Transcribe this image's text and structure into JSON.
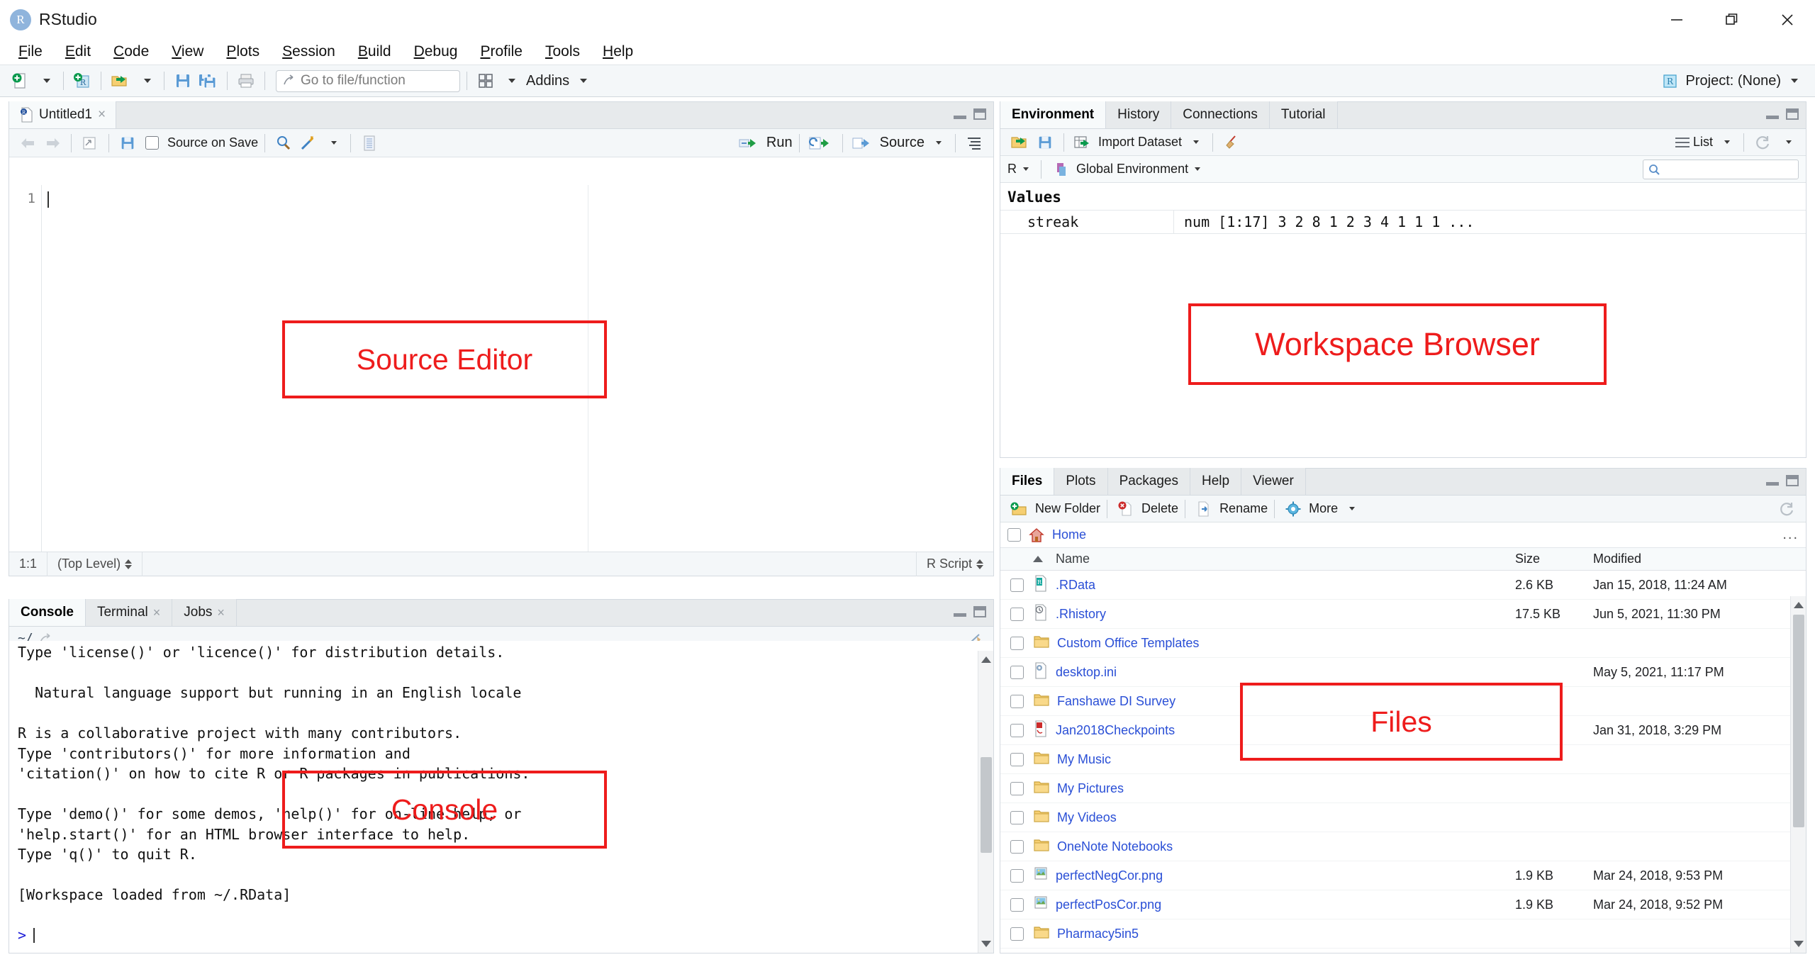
{
  "window": {
    "app_title": "RStudio",
    "logo_letter": "R",
    "controls": {
      "minimize": "minimize-button",
      "restore": "restore-button",
      "close": "close-button"
    }
  },
  "menubar": [
    {
      "label": "File",
      "accel": "F"
    },
    {
      "label": "Edit",
      "accel": "E"
    },
    {
      "label": "Code",
      "accel": "C"
    },
    {
      "label": "View",
      "accel": "V"
    },
    {
      "label": "Plots",
      "accel": "P"
    },
    {
      "label": "Session",
      "accel": "S"
    },
    {
      "label": "Build",
      "accel": "B"
    },
    {
      "label": "Debug",
      "accel": "D"
    },
    {
      "label": "Profile",
      "accel": "P"
    },
    {
      "label": "Tools",
      "accel": "T"
    },
    {
      "label": "Help",
      "accel": "H"
    }
  ],
  "toolbar": {
    "icons": [
      "new-file-icon",
      "new-project-icon",
      "open-file-icon",
      "save-icon",
      "save-all-icon",
      "print-icon"
    ],
    "goto_placeholder": "Go to file/function",
    "panes_icon": "panes-grid-icon",
    "addins_label": "Addins",
    "project_label": "Project: (None)",
    "project_icon": "r-cube-icon"
  },
  "source_editor": {
    "tab": {
      "label": "Untitled1",
      "icon": "r-script-icon",
      "close": "×"
    },
    "toolbar": {
      "back_icon": "back-arrow-icon",
      "forward_icon": "forward-arrow-icon",
      "popout_icon": "show-in-new-window-icon",
      "save_icon": "save-icon",
      "source_on_save_label": "Source on Save",
      "find_icon": "magnifier-icon",
      "wand_icon": "code-tools-wand-icon",
      "compile_icon": "compile-report-icon",
      "run_label": "Run",
      "rerun_icon": "rerun-icon",
      "source_label": "Source",
      "outline_icon": "document-outline-icon"
    },
    "gutter_line": "1",
    "status": {
      "position": "1:1",
      "scope": "(Top Level)",
      "file_type": "R Script"
    }
  },
  "console": {
    "tabs": [
      {
        "label": "Console",
        "active": true,
        "closable": false
      },
      {
        "label": "Terminal",
        "active": false,
        "closable": true
      },
      {
        "label": "Jobs",
        "active": false,
        "closable": true
      }
    ],
    "path": "~/",
    "path_icon": "open-in-window-icon",
    "lines": [
      "Type 'license()' or 'licence()' for distribution details.",
      "",
      "  Natural language support but running in an English locale",
      "",
      "R is a collaborative project with many contributors.",
      "Type 'contributors()' for more information and",
      "'citation()' on how to cite R or R packages in publications.",
      "",
      "Type 'demo()' for some demos, 'help()' for on-line help, or",
      "'help.start()' for an HTML browser interface to help.",
      "Type 'q()' to quit R.",
      "",
      "[Workspace loaded from ~/.RData]",
      ""
    ],
    "prompt": ">"
  },
  "environment": {
    "tabs": [
      {
        "label": "Environment",
        "active": true
      },
      {
        "label": "History",
        "active": false
      },
      {
        "label": "Connections",
        "active": false
      },
      {
        "label": "Tutorial",
        "active": false
      }
    ],
    "toolbar": {
      "load_icon": "load-workspace-icon",
      "save_icon": "save-workspace-icon",
      "import_label": "Import Dataset",
      "broom_icon": "clear-objects-broom-icon",
      "view_mode": "List",
      "refresh_icon": "refresh-icon"
    },
    "language": "R",
    "scope": "Global Environment",
    "scope_icon": "environment-icon",
    "search_icon": "search-icon",
    "search_value": "",
    "group_header": "Values",
    "variables": [
      {
        "name": "streak",
        "value": "num [1:17] 3 2 8 1 2 3 4 1 1 1 ..."
      }
    ]
  },
  "files": {
    "tabs": [
      {
        "label": "Files",
        "active": true
      },
      {
        "label": "Plots",
        "active": false
      },
      {
        "label": "Packages",
        "active": false
      },
      {
        "label": "Help",
        "active": false
      },
      {
        "label": "Viewer",
        "active": false
      }
    ],
    "toolbar": {
      "new_folder_label": "New Folder",
      "delete_label": "Delete",
      "rename_label": "Rename",
      "more_label": "More",
      "refresh_icon": "refresh-icon"
    },
    "breadcrumb": {
      "home_icon": "home-icon",
      "label": "Home",
      "overflow": "..."
    },
    "columns": {
      "name": "Name",
      "size": "Size",
      "modified": "Modified",
      "sort": "ascending"
    },
    "rows": [
      {
        "icon": "rdata-file-icon",
        "name": ".RData",
        "size": "2.6 KB",
        "modified": "Jan 15, 2018, 11:24 AM"
      },
      {
        "icon": "rhistory-file-icon",
        "name": ".Rhistory",
        "size": "17.5 KB",
        "modified": "Jun 5, 2021, 11:30 PM"
      },
      {
        "icon": "folder-icon",
        "name": "Custom Office Templates",
        "size": "",
        "modified": ""
      },
      {
        "icon": "ini-file-icon",
        "name": "desktop.ini",
        "size": "",
        "modified": "May 5, 2021, 11:17 PM"
      },
      {
        "icon": "folder-icon",
        "name": "Fanshawe DI Survey",
        "size": "",
        "modified": ""
      },
      {
        "icon": "pdf-file-icon",
        "name": "Jan2018Checkpoints",
        "size": "",
        "modified": "Jan 31, 2018, 3:29 PM"
      },
      {
        "icon": "folder-icon",
        "name": "My Music",
        "size": "",
        "modified": ""
      },
      {
        "icon": "folder-icon",
        "name": "My Pictures",
        "size": "",
        "modified": ""
      },
      {
        "icon": "folder-icon",
        "name": "My Videos",
        "size": "",
        "modified": ""
      },
      {
        "icon": "folder-icon",
        "name": "OneNote Notebooks",
        "size": "",
        "modified": ""
      },
      {
        "icon": "image-file-icon",
        "name": "perfectNegCor.png",
        "size": "1.9 KB",
        "modified": "Mar 24, 2018, 9:53 PM"
      },
      {
        "icon": "image-file-icon",
        "name": "perfectPosCor.png",
        "size": "1.9 KB",
        "modified": "Mar 24, 2018, 9:52 PM"
      },
      {
        "icon": "folder-icon",
        "name": "Pharmacy5in5",
        "size": "",
        "modified": ""
      }
    ]
  },
  "annotations": {
    "color": "#ee1c1c",
    "source_editor": "Source Editor",
    "workspace_browser": "Workspace Browser",
    "files": "Files",
    "console": "Console"
  }
}
